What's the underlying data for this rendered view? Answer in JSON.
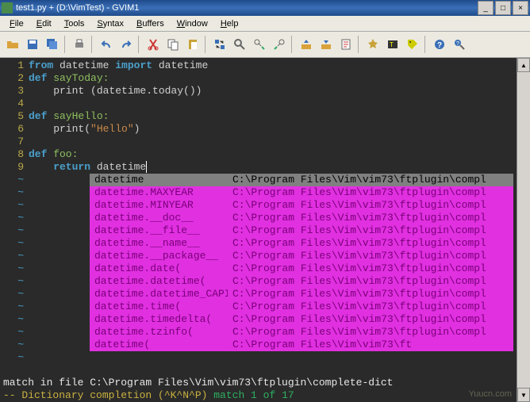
{
  "titlebar": {
    "text": "test1.py + (D:\\VimTest) - GVIM1"
  },
  "winbtns": {
    "min": "_",
    "max": "□",
    "close": "×"
  },
  "menu": {
    "file": "File",
    "edit": "Edit",
    "tools": "Tools",
    "syntax": "Syntax",
    "buffers": "Buffers",
    "window": "Window",
    "help": "Help"
  },
  "gutter": {
    "l1": "1",
    "l2": "2",
    "l3": "3",
    "l4": "4",
    "l5": "5",
    "l6": "6",
    "l7": "7",
    "l8": "8",
    "l9": "9",
    "tilde": "~"
  },
  "code": {
    "l1a": "from",
    "l1b": " datetime ",
    "l1c": "import",
    "l1d": " datetime",
    "l2a": "def",
    "l2b": " sayToday:",
    "l3a": "    print ",
    "l3b": "(datetime.today())",
    "l5a": "def",
    "l5b": " sayHello:",
    "l6a": "    print(",
    "l6b": "\"Hello\"",
    "l6c": ")",
    "l8a": "def",
    "l8b": " foo:",
    "l9a": "    return ",
    "l9b": "datetime"
  },
  "popup": {
    "items": [
      {
        "k": "datetime",
        "p": "C:\\Program Files\\Vim\\vim73\\ftplugin\\compl",
        "sel": true
      },
      {
        "k": "datetime.MAXYEAR",
        "p": "C:\\Program Files\\Vim\\vim73\\ftplugin\\compl"
      },
      {
        "k": "datetime.MINYEAR",
        "p": "C:\\Program Files\\Vim\\vim73\\ftplugin\\compl"
      },
      {
        "k": "datetime.__doc__",
        "p": "C:\\Program Files\\Vim\\vim73\\ftplugin\\compl"
      },
      {
        "k": "datetime.__file__",
        "p": "C:\\Program Files\\Vim\\vim73\\ftplugin\\compl"
      },
      {
        "k": "datetime.__name__",
        "p": "C:\\Program Files\\Vim\\vim73\\ftplugin\\compl"
      },
      {
        "k": "datetime.__package__",
        "p": "C:\\Program Files\\Vim\\vim73\\ftplugin\\compl"
      },
      {
        "k": "datetime.date(",
        "p": "C:\\Program Files\\Vim\\vim73\\ftplugin\\compl"
      },
      {
        "k": "datetime.datetime(",
        "p": "C:\\Program Files\\Vim\\vim73\\ftplugin\\compl"
      },
      {
        "k": "datetime.datetime_CAPI",
        "p": "C:\\Program Files\\Vim\\vim73\\ftplugin\\compl"
      },
      {
        "k": "datetime.time(",
        "p": "C:\\Program Files\\Vim\\vim73\\ftplugin\\compl"
      },
      {
        "k": "datetime.timedelta(",
        "p": "C:\\Program Files\\Vim\\vim73\\ftplugin\\compl"
      },
      {
        "k": "datetime.tzinfo(",
        "p": "C:\\Program Files\\Vim\\vim73\\ftplugin\\compl"
      },
      {
        "k": "datetime(",
        "p": "C:\\Program Files\\Vim\\vim73\\ft"
      }
    ]
  },
  "status": {
    "line1": "match in file C:\\Program Files\\Vim\\vim73\\ftplugin\\complete-dict",
    "line2a": "-- Dictionary completion (^K^N^P) ",
    "line2b": "match 1 of 17"
  },
  "watermark": "Yuucn.com"
}
